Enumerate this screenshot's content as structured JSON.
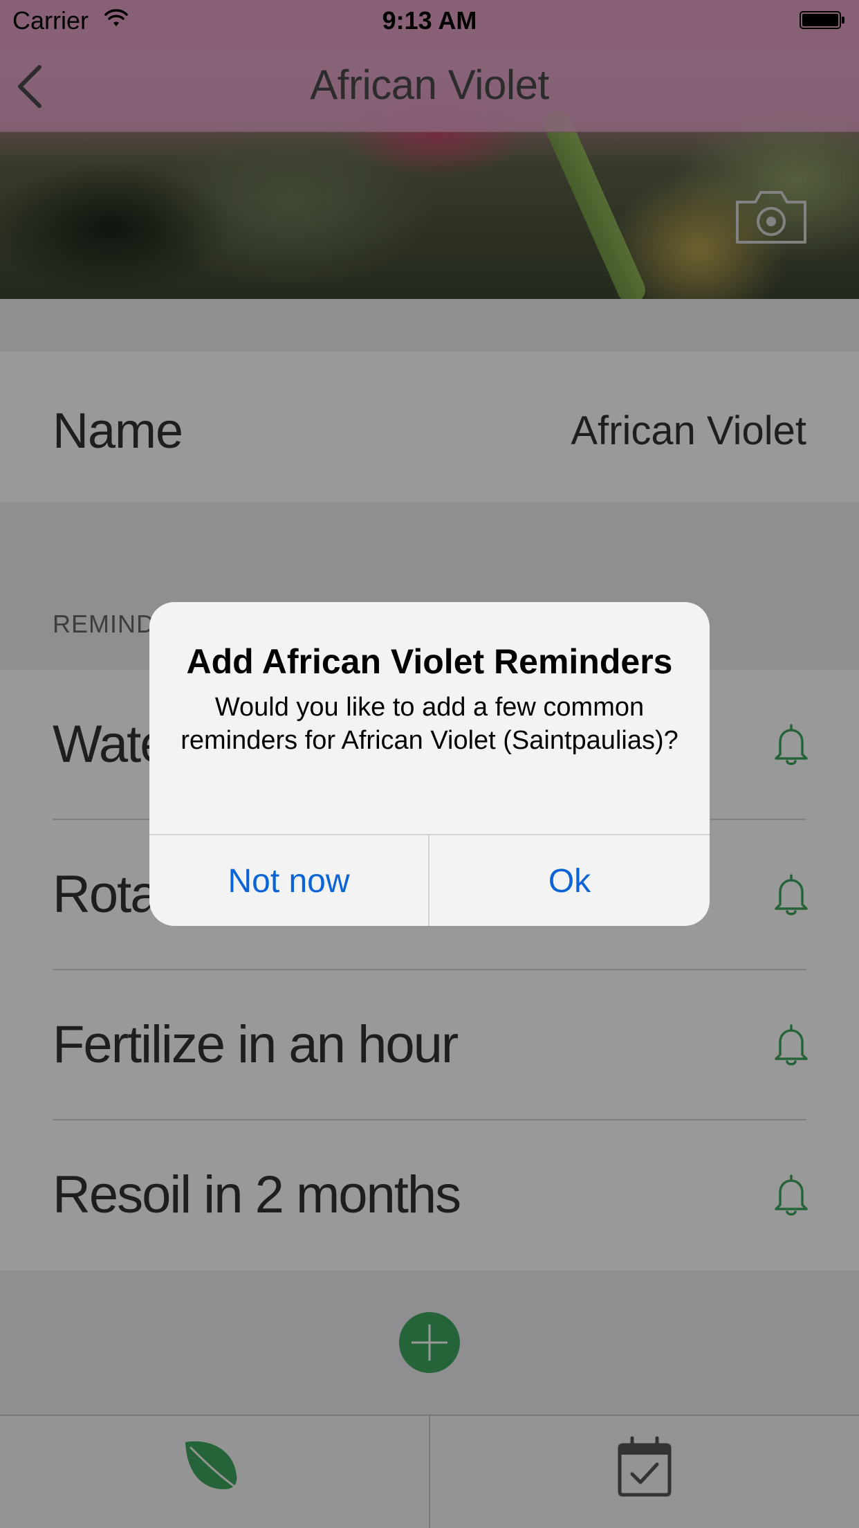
{
  "status_bar": {
    "carrier": "Carrier",
    "time": "9:13 AM"
  },
  "nav": {
    "title": "African Violet",
    "back_icon": "chevron-left-icon",
    "camera_icon": "camera-icon"
  },
  "plant": {
    "name_label": "Name",
    "name_value": "African Violet"
  },
  "reminders": {
    "section_header": "REMINDERS",
    "items": [
      {
        "label": "Water",
        "icon": "bell-icon"
      },
      {
        "label": "Rotate",
        "icon": "bell-icon"
      },
      {
        "label": "Fertilize in an hour",
        "icon": "bell-icon"
      },
      {
        "label": "Resoil in 2 months",
        "icon": "bell-icon"
      }
    ],
    "add_icon": "plus-icon"
  },
  "tab_bar": {
    "tabs": [
      {
        "icon": "leaf-icon",
        "active": true
      },
      {
        "icon": "calendar-check-icon",
        "active": false
      }
    ]
  },
  "alert": {
    "title": "Add African Violet Reminders",
    "message": "Would you like to add a few common reminders for African Violet (Saintpaulias)?",
    "cancel_label": "Not now",
    "confirm_label": "Ok"
  },
  "colors": {
    "accent_green": "#3fa560",
    "alert_button_blue": "#0a64d8"
  }
}
